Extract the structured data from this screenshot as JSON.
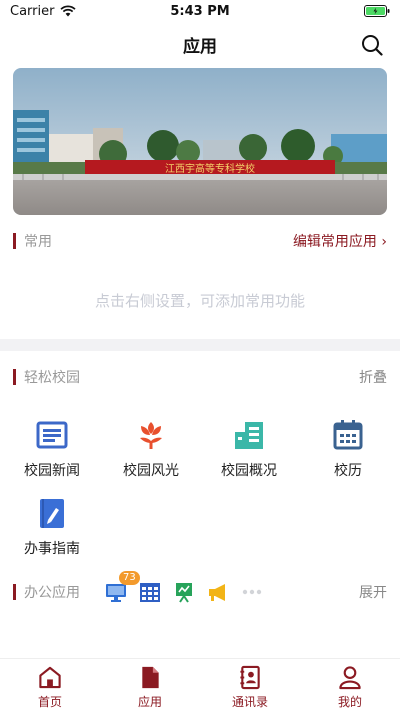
{
  "status": {
    "carrier": "Carrier",
    "time": "5:43 PM"
  },
  "nav": {
    "title": "应用",
    "search_icon": "search-icon"
  },
  "banner": {
    "sign_text": "江西宇高等专科学校"
  },
  "common": {
    "title": "常用",
    "action": "编辑常用应用 ›",
    "hint": "点击右侧设置，可添加常用功能"
  },
  "campus": {
    "title": "轻松校园",
    "action": "折叠",
    "items": [
      {
        "label": "校园新闻",
        "icon": "news-icon"
      },
      {
        "label": "校园风光",
        "icon": "flower-icon"
      },
      {
        "label": "校园概况",
        "icon": "buildings-icon"
      },
      {
        "label": "校历",
        "icon": "calendar-icon"
      },
      {
        "label": "办事指南",
        "icon": "guide-book-icon"
      }
    ]
  },
  "office": {
    "title": "办公应用",
    "action": "展开",
    "badge": "73",
    "icons": [
      "monitor-icon",
      "grid-calendar-icon",
      "chart-board-icon",
      "megaphone-icon",
      "more-icon"
    ]
  },
  "tabs": [
    {
      "label": "首页",
      "icon": "home-icon"
    },
    {
      "label": "应用",
      "icon": "app-document-icon"
    },
    {
      "label": "通讯录",
      "icon": "contacts-icon"
    },
    {
      "label": "我的",
      "icon": "profile-icon"
    }
  ],
  "colors": {
    "accent": "#8b1a22",
    "hint": "#c8cbd4",
    "badge": "#f39a2c",
    "divider": "#f2f2f4"
  }
}
